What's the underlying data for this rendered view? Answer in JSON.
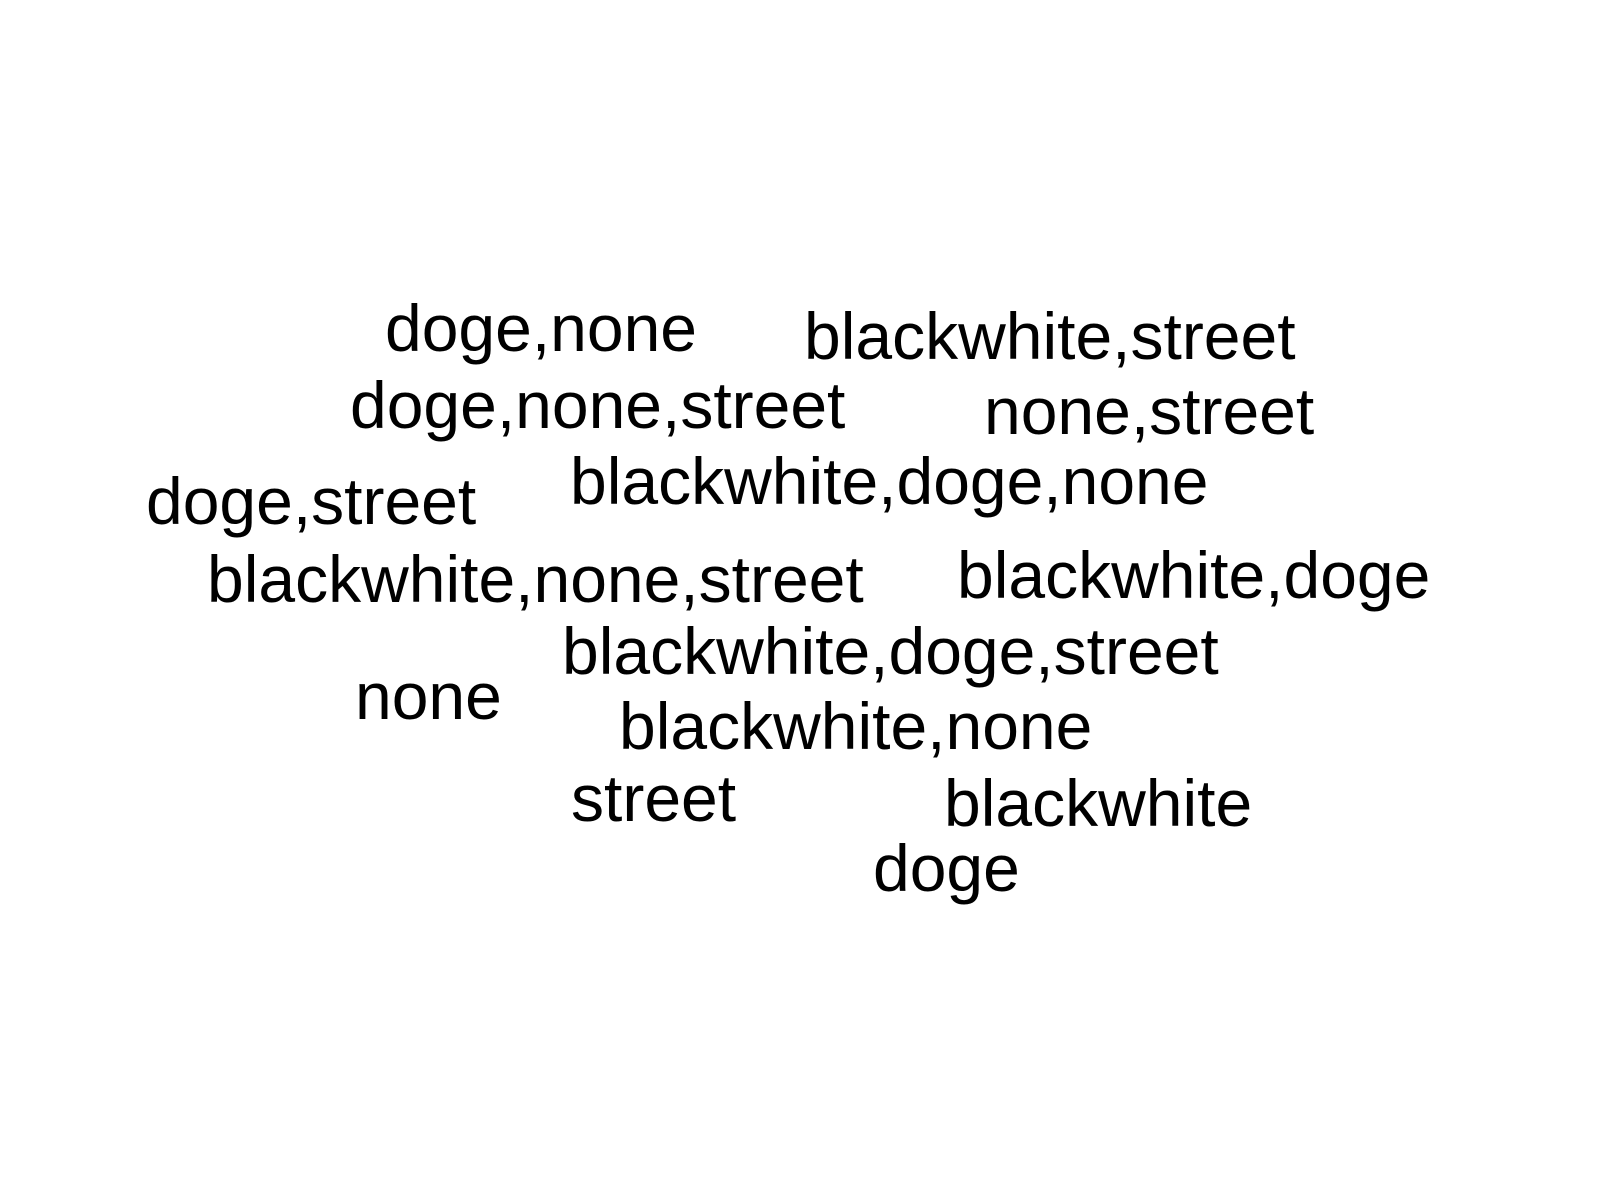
{
  "text_color": "#000000",
  "background_color": "#ffffff",
  "words": [
    "doge,none",
    "blackwhite,street",
    "doge,none,street",
    "none,street",
    "blackwhite,doge,none",
    "doge,street",
    "blackwhite,none,street",
    "blackwhite,doge",
    "blackwhite,doge,street",
    "none",
    "blackwhite,none",
    "street",
    "blackwhite",
    "doge"
  ]
}
